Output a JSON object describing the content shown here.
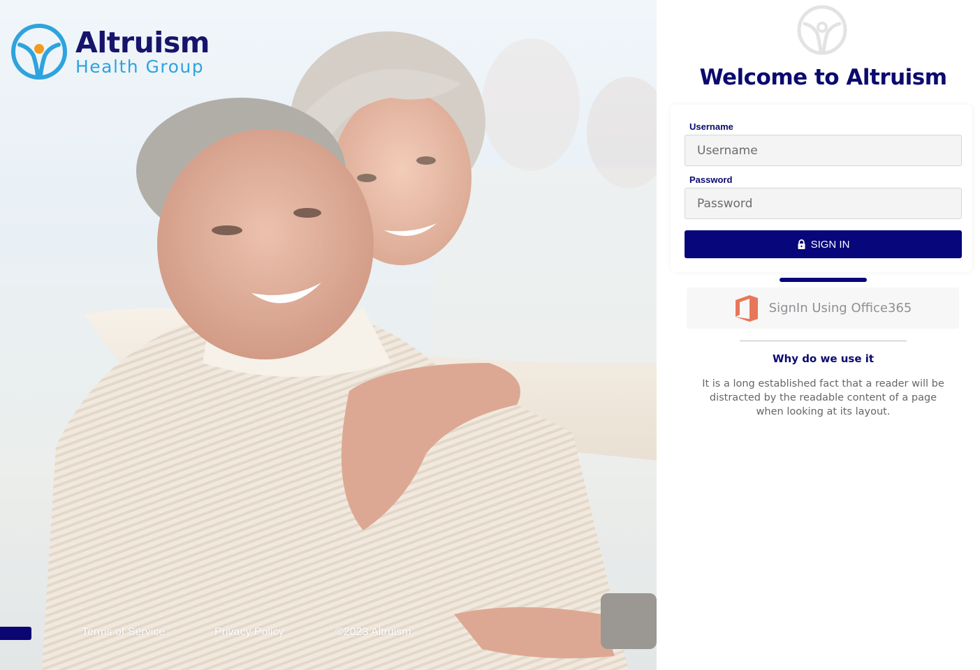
{
  "brand": {
    "name": "Altruism",
    "subtitle": "Health Group",
    "colors": {
      "navy": "#0b0a6e",
      "button": "#07067a",
      "sky": "#2fa3dd",
      "orange": "#f39a1f",
      "office": "#e8775a"
    }
  },
  "hero": {
    "image": "senior-couple-hugging-photo"
  },
  "footer": {
    "terms_label": "Terms of Service",
    "privacy_label": "Privacy Policy",
    "copyright": "©2023 Altruism."
  },
  "login": {
    "welcome_title": "Welcome to Altruism",
    "username_label": "Username",
    "username_placeholder": "Username",
    "password_label": "Password",
    "password_placeholder": "Password",
    "signin_label": "SIGN IN",
    "signin_icon": "lock-icon",
    "office_label": "SignIn Using Office365",
    "office_icon": "office365-icon"
  },
  "info": {
    "title": "Why do we use it",
    "body": "It is a long established fact that a reader will be distracted by the readable content of a page when looking at its layout."
  }
}
